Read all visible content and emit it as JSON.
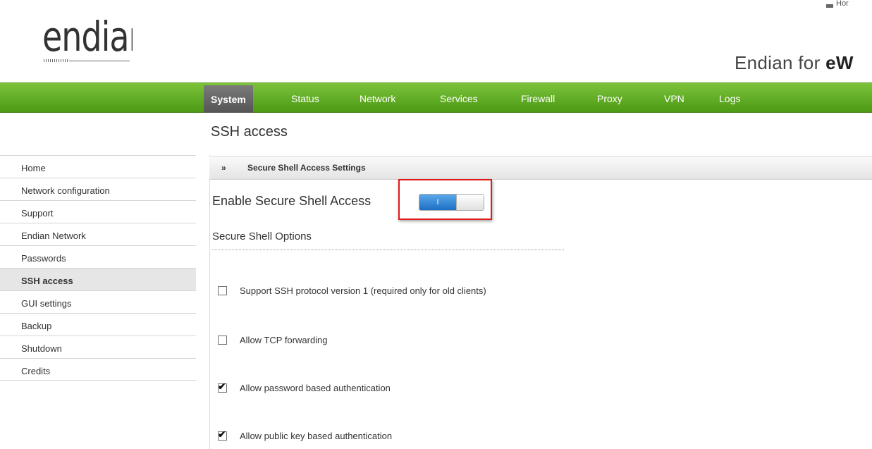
{
  "header": {
    "logo_text": "endian",
    "product_prefix": "Endian for ",
    "product_bold": "eW",
    "corner_text": "Hor"
  },
  "topnav": {
    "items": [
      {
        "label": "System",
        "active": true
      },
      {
        "label": "Status"
      },
      {
        "label": "Network"
      },
      {
        "label": "Services"
      },
      {
        "label": "Firewall"
      },
      {
        "label": "Proxy"
      },
      {
        "label": "VPN"
      },
      {
        "label": "Logs"
      }
    ]
  },
  "page": {
    "title": "SSH access"
  },
  "sidebar": {
    "items": [
      {
        "label": "Home"
      },
      {
        "label": "Network configuration"
      },
      {
        "label": "Support"
      },
      {
        "label": "Endian Network"
      },
      {
        "label": "Passwords"
      },
      {
        "label": "SSH access",
        "active": true
      },
      {
        "label": "GUI settings"
      },
      {
        "label": "Backup"
      },
      {
        "label": "Shutdown"
      },
      {
        "label": "Credits"
      }
    ]
  },
  "section": {
    "chevron": "»",
    "title": "Secure Shell Access Settings"
  },
  "enable": {
    "label": "Enable Secure Shell Access",
    "toggle_text": "I",
    "state": "on"
  },
  "options": {
    "heading": "Secure Shell Options",
    "items": [
      {
        "label": "Support SSH protocol version 1 (required only for old clients)",
        "checked": false
      },
      {
        "label": "Allow TCP forwarding",
        "checked": false
      },
      {
        "label": "Allow password based authentication",
        "checked": true
      },
      {
        "label": "Allow public key based authentication",
        "checked": true
      }
    ]
  },
  "colors": {
    "nav_green": "#5ea622",
    "active_tab": "#666666",
    "toggle_blue": "#2a7fd4",
    "highlight_red": "#e01919"
  }
}
